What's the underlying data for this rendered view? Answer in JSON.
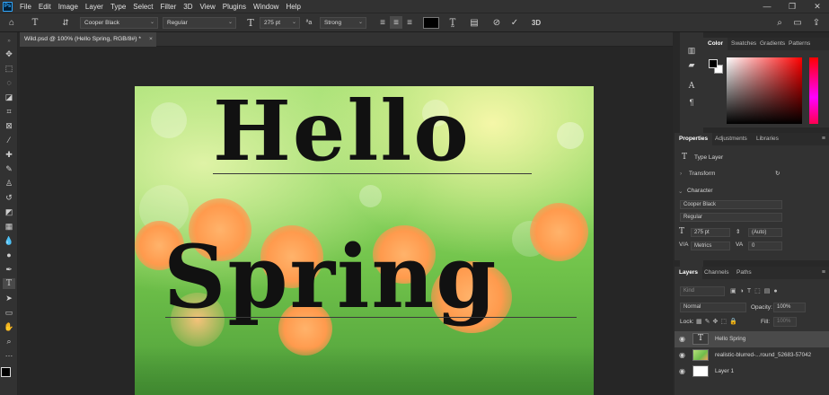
{
  "app": {
    "logo": "Ps"
  },
  "menu": [
    "File",
    "Edit",
    "Image",
    "Layer",
    "Type",
    "Select",
    "Filter",
    "3D",
    "View",
    "Plugins",
    "Window",
    "Help"
  ],
  "window_controls": {
    "minimize": "—",
    "restore": "❐",
    "close": "✕"
  },
  "options_bar": {
    "font_family": "Cooper Black",
    "font_style": "Regular",
    "font_size": "275 pt",
    "aa_label": "ªa",
    "antialias": "Strong",
    "text_color": "#000000"
  },
  "document": {
    "tab_title": "Wild.psd @ 100% (Hello Spring, RGB/8#) *",
    "close": "×"
  },
  "canvas_text": {
    "line1": "Hello",
    "line2": "Spring"
  },
  "color_panel": {
    "tabs": [
      "Color",
      "Swatches",
      "Gradients",
      "Patterns"
    ],
    "active": "Color"
  },
  "properties_panel": {
    "tabs": [
      "Properties",
      "Adjustments",
      "Libraries"
    ],
    "type_label": "Type Layer",
    "transform_label": "Transform",
    "character_label": "Character",
    "font_family": "Cooper Black",
    "font_style": "Regular",
    "font_size": "275 pt",
    "leading": "(Auto)",
    "kerning": "Metrics",
    "tracking": "0"
  },
  "layers_panel": {
    "tabs": [
      "Layers",
      "Channels",
      "Paths"
    ],
    "filter_placeholder": "Kind",
    "blend_mode": "Normal",
    "opacity_label": "Opacity:",
    "opacity": "100%",
    "lock_label": "Lock:",
    "fill_label": "Fill:",
    "fill": "100%",
    "layers": [
      {
        "name": "Hello Spring",
        "kind": "text"
      },
      {
        "name": "realistic-blurred-...round_52683-57042",
        "kind": "image"
      },
      {
        "name": "Layer 1",
        "kind": "fill"
      }
    ]
  }
}
